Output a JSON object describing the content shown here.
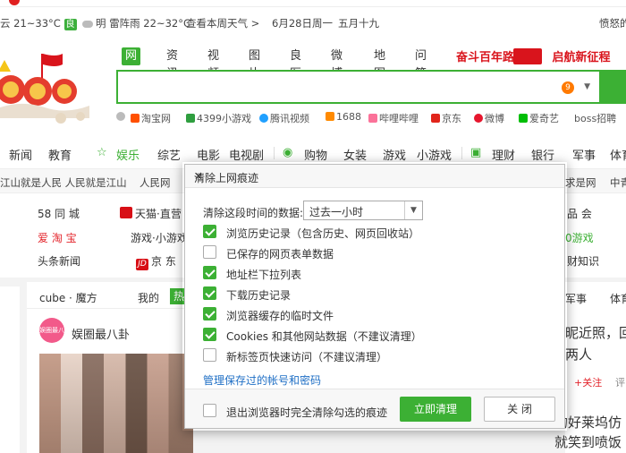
{
  "header": {
    "weather_today": "云 21~33°C",
    "air_quality": "良",
    "weather_tomorrow": "明 雷阵雨 22~32°C",
    "week_weather_link": "查看本周天气 >",
    "date": "6月28日周一",
    "lunar_date": "五月十九",
    "login_hint": "愤怒的"
  },
  "search": {
    "tabs": [
      "网页",
      "资讯",
      "视频",
      "图片",
      "良医",
      "微博",
      "地图",
      "问答"
    ],
    "active_tab": "网页",
    "promo_text_left": "奋斗百年路",
    "promo_text_right": "启航新征程",
    "query": "",
    "notification_count": "9"
  },
  "quick_links": [
    "淘宝网",
    "4399小游戏",
    "腾讯视频",
    "1688",
    "哔哩哔哩",
    "京东",
    "微博",
    "爱奇艺",
    "boss招聘"
  ],
  "category_nav": [
    "新闻",
    "教育",
    "娱乐",
    "综艺",
    "电影",
    "电视剧",
    "购物",
    "女装",
    "游戏",
    "小游戏",
    "理财",
    "银行",
    "军事",
    "体育"
  ],
  "ticker": [
    "江山就是人民 人民就是江山",
    "人民网",
    "求是网",
    "中青"
  ],
  "sites": {
    "row1": [
      "58 同 城",
      "天猫·直营",
      "品 会"
    ],
    "row2": [
      "爱 淘 宝",
      "游戏·小游戏",
      "0游戏"
    ],
    "row3": [
      "头条新闻",
      "京 东",
      "财知识"
    ]
  },
  "feed": {
    "tabs": [
      "cube · 魔方",
      "我的",
      "热"
    ],
    "avatar_text": "娱圈最八卦",
    "author": "娱圈最八卦"
  },
  "right_column": {
    "tab": "军事",
    "tab2": "体育",
    "headline1": "昵近照，回",
    "headline2": "两人",
    "follow": "+关注",
    "comment": "评",
    "headline3": "的好莱坞仿",
    "headline4": "就笑到喷饭"
  },
  "dialog": {
    "title": "清除上网痕迹",
    "close_glyph": "✕",
    "range_label": "清除这段时间的数据:",
    "range_value": "过去一小时",
    "options": [
      {
        "label": "浏览历史记录（包含历史、网页回收站）",
        "checked": true
      },
      {
        "label": "已保存的网页表单数据",
        "checked": false
      },
      {
        "label": "地址栏下拉列表",
        "checked": true
      },
      {
        "label": "下载历史记录",
        "checked": true
      },
      {
        "label": "浏览器缓存的临时文件",
        "checked": true
      },
      {
        "label": "Cookies 和其他网站数据（不建议清理）",
        "checked": true
      },
      {
        "label": "新标签页快速访问（不建议清理）",
        "checked": false
      }
    ],
    "manage_link": "管理保存过的帐号和密码",
    "exit_option": "退出浏览器时完全清除勾选的痕迹",
    "exit_checked": false,
    "clear_button": "立即清理",
    "close_button": "关 闭"
  }
}
